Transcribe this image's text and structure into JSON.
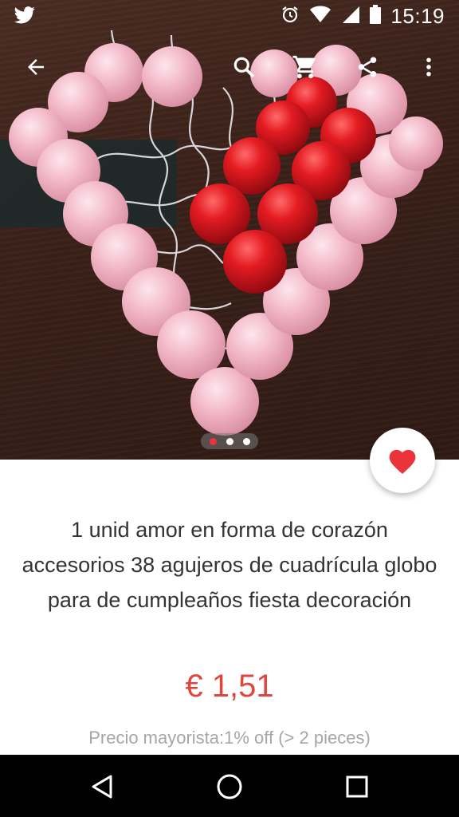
{
  "status_bar": {
    "time": "15:19",
    "icons": [
      "twitter-icon",
      "alarm-icon",
      "wifi-icon",
      "signal-icon",
      "battery-icon"
    ]
  },
  "toolbar": {
    "icons": [
      "back-arrow-icon",
      "search-icon",
      "cart-icon",
      "share-icon",
      "more-vert-icon"
    ]
  },
  "gallery": {
    "image_count": 3,
    "active_index": 0
  },
  "product": {
    "title": "1 unid amor en forma de corazón accesorios 38 agujeros de cuadrícula globo para de cumpleaños fiesta decoración",
    "price": "€ 1,51",
    "wholesale": "Precio mayorista:1% off (> 2 pieces)"
  },
  "favorite": {
    "icon": "heart-icon",
    "active": true
  },
  "colors": {
    "accent": "#e8343a",
    "price": "#e0463e",
    "pink_balloon": "#f3b8c6",
    "red_balloon": "#d8141c"
  },
  "nav_bar": {
    "icons": [
      "back-triangle-icon",
      "home-circle-icon",
      "recents-square-icon"
    ]
  }
}
